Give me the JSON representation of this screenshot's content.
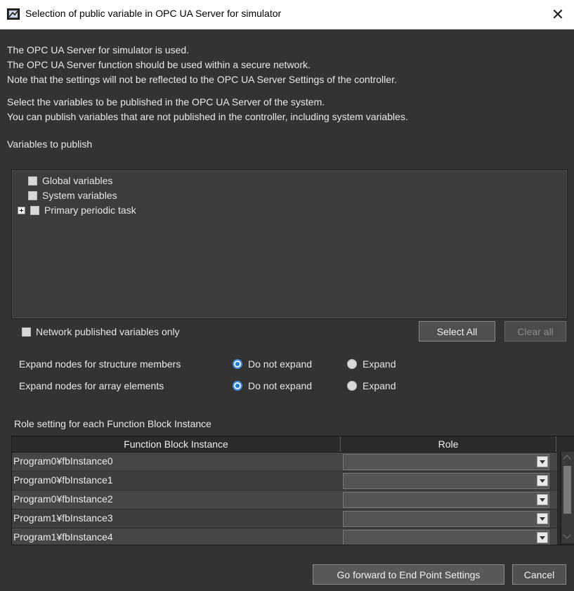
{
  "window": {
    "title": "Selection of public variable in OPC UA Server for simulator",
    "close_glyph": "✕"
  },
  "intro": {
    "lines": [
      "The OPC UA Server for simulator is used.",
      "The OPC UA Server function should be used within a secure network.",
      "Note that the settings will not be reflected to the OPC UA Server Settings of the controller."
    ],
    "select_lines": [
      "Select the variables to be published in the OPC UA Server of the system.",
      "You can publish variables that are not published in the controller, including system variables."
    ]
  },
  "variables": {
    "label": "Variables to publish",
    "tree_items": [
      {
        "label": "Global variables",
        "checked": false,
        "expandable": false
      },
      {
        "label": "System variables",
        "checked": false,
        "expandable": false
      },
      {
        "label": "Primary periodic task",
        "checked": false,
        "expandable": true
      }
    ],
    "network_only_label": "Network published variables only",
    "network_only_checked": false,
    "select_all_label": "Select All",
    "clear_all_label": "Clear all"
  },
  "expand_options": [
    {
      "label": "Expand nodes for structure members",
      "options": [
        "Do not expand",
        "Expand"
      ],
      "selected": "Do not expand"
    },
    {
      "label": "Expand nodes for array elements",
      "options": [
        "Do not expand",
        "Expand"
      ],
      "selected": "Do not expand"
    }
  ],
  "roles": {
    "label": "Role setting for each Function Block Instance",
    "columns": [
      "Function Block Instance",
      "Role"
    ],
    "rows": [
      {
        "instance": "Program0¥fbInstance0",
        "role": ""
      },
      {
        "instance": "Program0¥fbInstance1",
        "role": ""
      },
      {
        "instance": "Program0¥fbInstance2",
        "role": ""
      },
      {
        "instance": "Program1¥fbInstance3",
        "role": ""
      },
      {
        "instance": "Program1¥fbInstance4",
        "role": ""
      }
    ]
  },
  "footer": {
    "forward_label": "Go forward to End Point Settings",
    "cancel_label": "Cancel"
  },
  "colors": {
    "background": "#333333",
    "titlebar": "#ffffff",
    "radio_selected": "#3d8ee0"
  }
}
